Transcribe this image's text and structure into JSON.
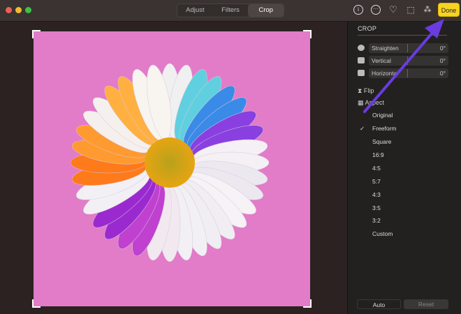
{
  "toolbar": {
    "tabs": [
      "Adjust",
      "Filters",
      "Crop"
    ],
    "active_tab": "Crop",
    "icons": [
      "info-icon",
      "more-icon",
      "heart-icon",
      "rotate-icon",
      "magic-wand-icon"
    ],
    "done_label": "Done"
  },
  "sidebar": {
    "title": "CROP",
    "sliders": [
      {
        "label": "Straighten",
        "value": "0°"
      },
      {
        "label": "Vertical",
        "value": "0°"
      },
      {
        "label": "Horizontal",
        "value": "0°"
      }
    ],
    "flip_label": "Flip",
    "aspect_label": "Aspect",
    "aspect_options": [
      "Original",
      "Freeform",
      "Square",
      "16:9",
      "4:5",
      "5:7",
      "4:3",
      "3:5",
      "3:2",
      "Custom"
    ],
    "selected_aspect": "Freeform",
    "check": "✓",
    "auto_label": "Auto",
    "reset_label": "Reset"
  },
  "colors": {
    "done": "#f7d322",
    "photo_bg": "#e27bc8",
    "annotation_arrow": "#6a3ce0"
  }
}
